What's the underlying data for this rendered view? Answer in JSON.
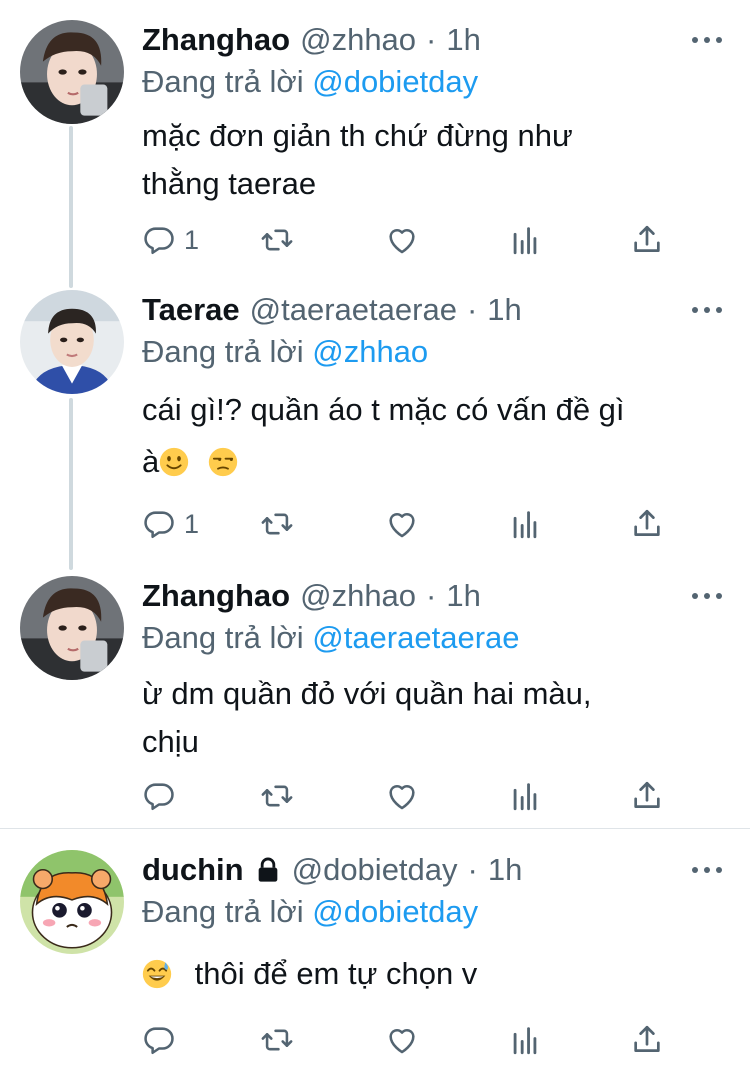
{
  "tweets": [
    {
      "display_name": "Zhanghao",
      "handle": "@zhhao",
      "dot": "·",
      "time": "1h",
      "replying_prefix": "Đang trả lời ",
      "replying_to": "@dobietday",
      "text_lines": [
        "mặc đơn giản th chứ đừng như",
        "thằng taerae"
      ],
      "reply_count": "1",
      "avatar": "zhanghao-avatar"
    },
    {
      "display_name": "Taerae",
      "handle": "@taeraetaerae",
      "dot": "·",
      "time": "1h",
      "replying_prefix": "Đang trả lời ",
      "replying_to": "@zhhao",
      "text_lines": [
        "cái gì!? quần áo t mặc có vấn đề gì",
        "à"
      ],
      "emojis": [
        "slightly-smiling-face",
        "unamused-face"
      ],
      "reply_count": "1",
      "avatar": "taerae-avatar"
    },
    {
      "display_name": "Zhanghao",
      "handle": "@zhhao",
      "dot": "·",
      "time": "1h",
      "replying_prefix": "Đang trả lời ",
      "replying_to": "@taeraetaerae",
      "text_lines": [
        "ừ dm quần đỏ với quần hai màu,",
        "chịu"
      ],
      "reply_count": "",
      "avatar": "zhanghao-avatar"
    },
    {
      "display_name": "duchin",
      "handle": "@dobietday",
      "dot": "·",
      "time": "1h",
      "replying_prefix": "Đang trả lời ",
      "replying_to": "@dobietday",
      "text_lines": [
        "thôi để em tự chọn v"
      ],
      "emojis": [
        "grinning-face-with-sweat"
      ],
      "reply_count": "",
      "locked": true,
      "avatar": "hamster-avatar"
    }
  ],
  "colors": {
    "link": "#1d9bf0",
    "muted": "#536471",
    "text": "#0f1419",
    "thread_line": "#cfd9de"
  },
  "icons": [
    "reply-icon",
    "retweet-icon",
    "like-icon",
    "analytics-icon",
    "share-icon",
    "more-icon",
    "lock-icon"
  ]
}
